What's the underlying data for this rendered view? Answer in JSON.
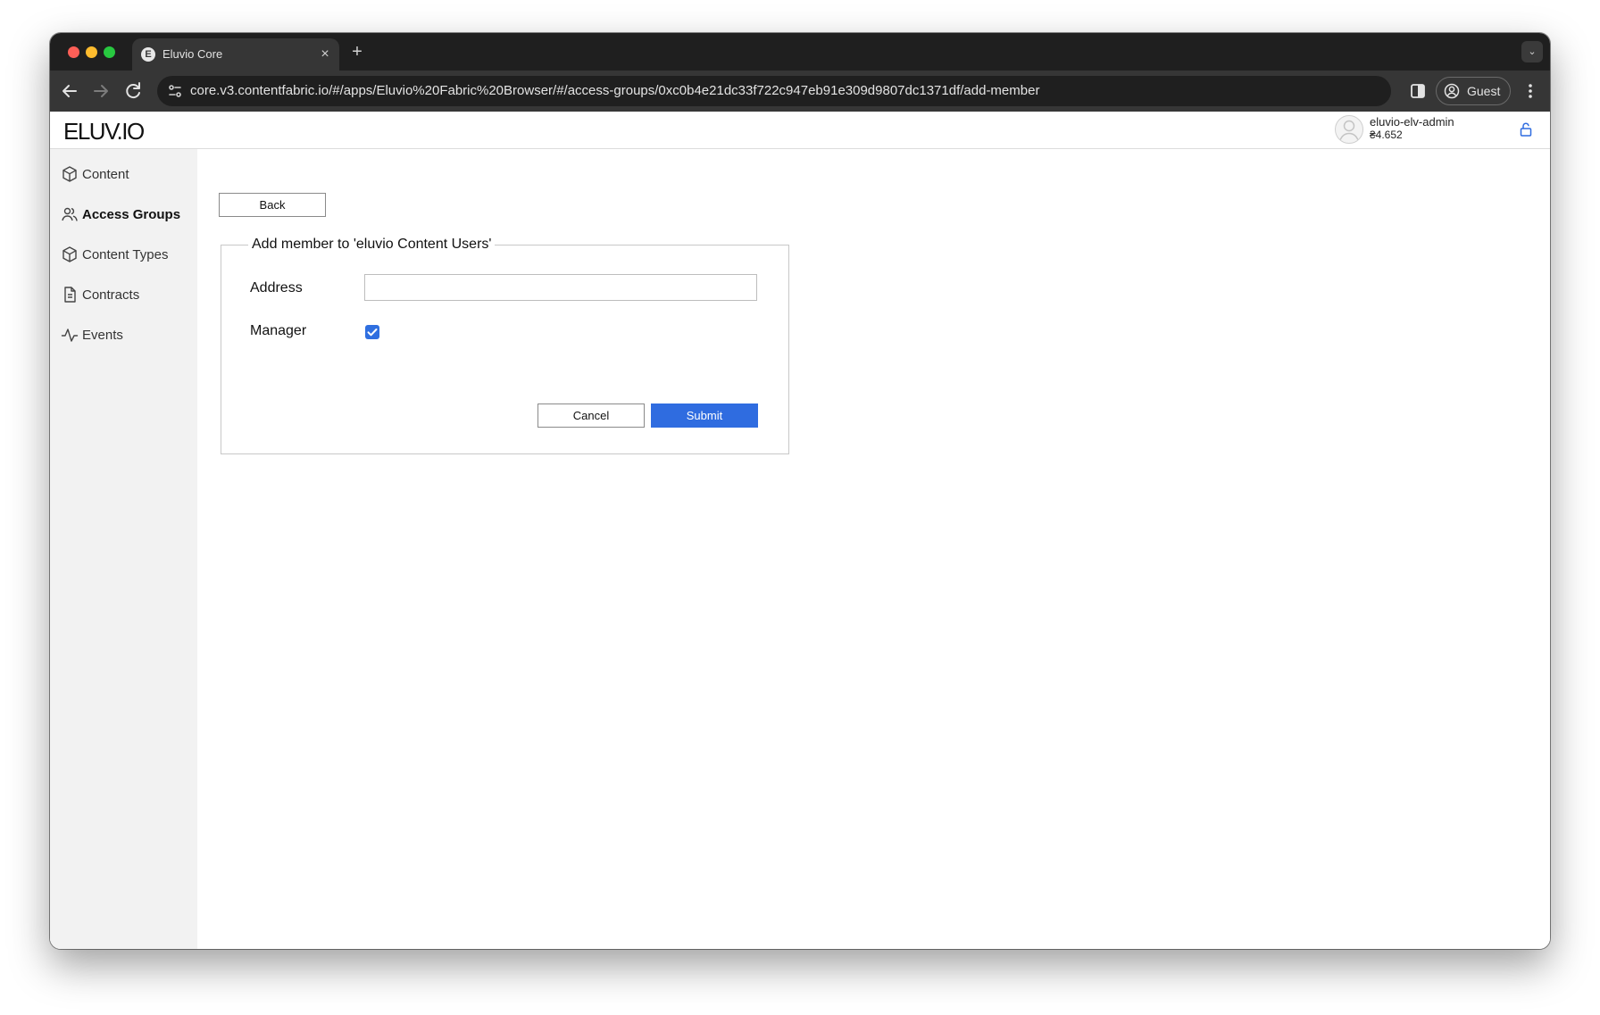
{
  "browser": {
    "tab": {
      "favicon_letter": "E",
      "title": "Eluvio Core",
      "close_glyph": "×"
    },
    "new_tab_glyph": "+",
    "tab_dropdown_glyph": "⌄",
    "url": "core.v3.contentfabric.io/#/apps/Eluvio%20Fabric%20Browser/#/access-groups/0xc0b4e21dc33f722c947eb91e309d9807dc1371df/add-member",
    "profile_label": "Guest",
    "icons": {
      "back": "back-arrow-icon",
      "forward": "forward-arrow-icon",
      "reload": "reload-icon",
      "site_info": "tune-icon",
      "side_panel": "side-panel-icon",
      "profile": "profile-icon",
      "menu": "kebab-menu-icon"
    }
  },
  "app": {
    "logo": "ELUV.IO",
    "user": {
      "name": "eluvio-elv-admin",
      "balance": "₴4.652"
    },
    "accent_color": "#2f6ce0",
    "sidebar": {
      "items": [
        {
          "label": "Content",
          "icon": "box-icon",
          "active": false
        },
        {
          "label": "Access Groups",
          "icon": "users-icon",
          "active": true
        },
        {
          "label": "Content Types",
          "icon": "box-icon",
          "active": false
        },
        {
          "label": "Contracts",
          "icon": "document-icon",
          "active": false
        },
        {
          "label": "Events",
          "icon": "activity-icon",
          "active": false
        }
      ]
    },
    "main": {
      "back_label": "Back",
      "form": {
        "legend": "Add member to 'eluvio Content Users'",
        "address_label": "Address",
        "address_value": "",
        "manager_label": "Manager",
        "manager_checked": true,
        "cancel_label": "Cancel",
        "submit_label": "Submit"
      }
    }
  }
}
